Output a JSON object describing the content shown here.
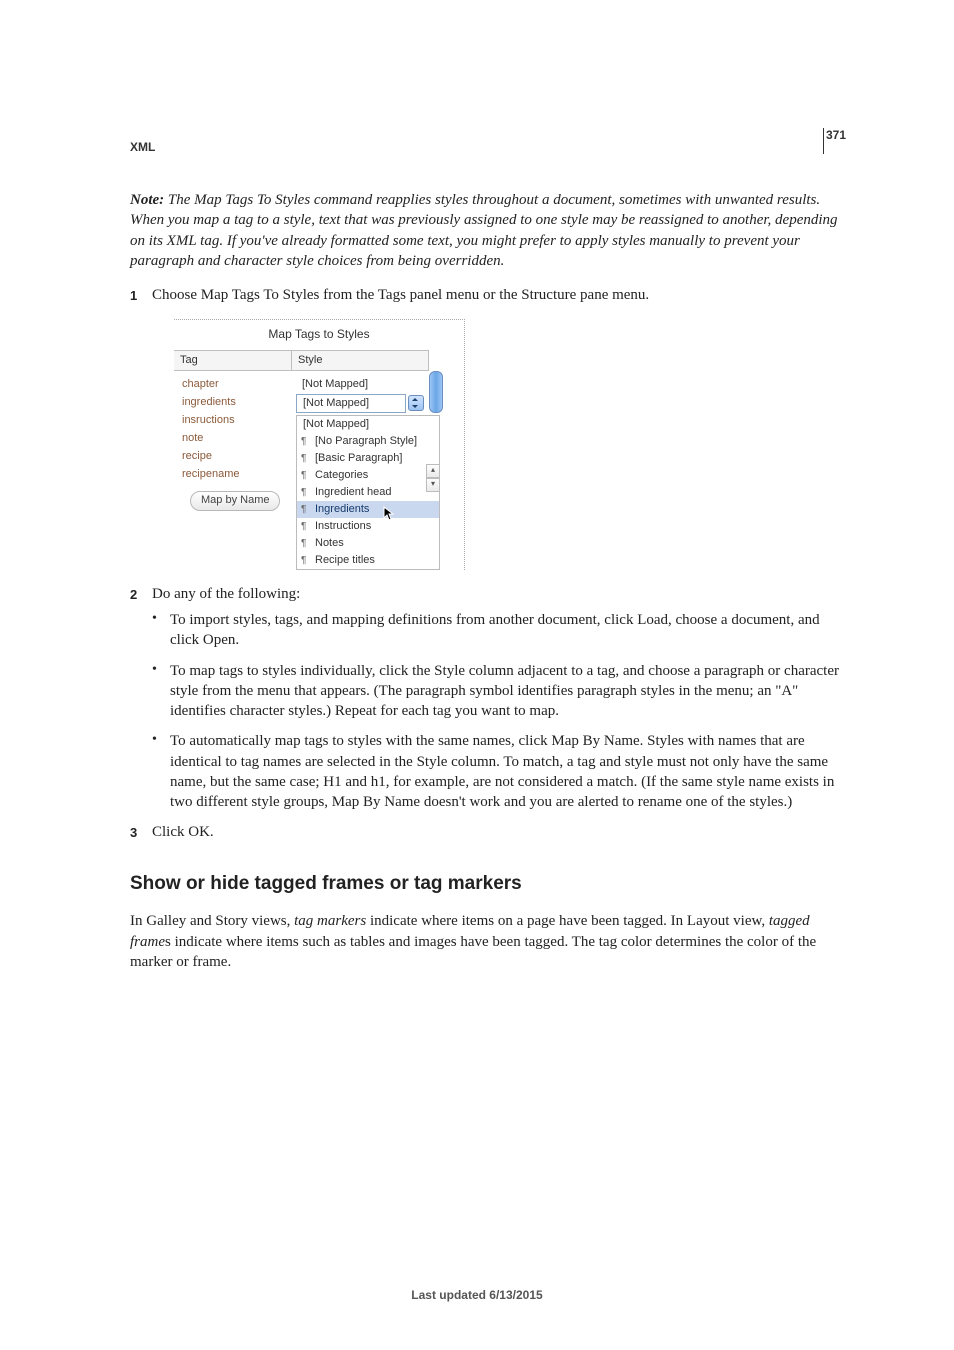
{
  "header": {
    "section": "XML",
    "page_number": "371"
  },
  "note": {
    "label": "Note:",
    "text": "The Map Tags To Styles command reapplies styles throughout a document, sometimes with unwanted results. When you map a tag to a style, text that was previously assigned to one style may be reassigned to another, depending on its XML tag. If you've already formatted some text, you might prefer to apply styles manually to prevent your paragraph and character style choices from being overridden."
  },
  "steps": {
    "s1": "Choose Map Tags To Styles from the Tags panel menu or the Structure pane menu.",
    "s2_intro": "Do any of the following:",
    "s2_bullets": [
      "To import styles, tags, and mapping definitions from another document, click Load, choose a document, and click Open.",
      "To map tags to styles individually, click the Style column adjacent to a tag, and choose a paragraph or character style from the menu that appears. (The paragraph symbol identifies paragraph styles in the menu; an \"A\" identifies character styles.) Repeat for each tag you want to map.",
      "To automatically map tags to styles with the same names, click Map By Name. Styles with names that are identical to tag names are selected in the Style column. To match, a tag and style must not only have the same name, but the same case; H1 and h1, for example, are not considered a match. (If the same style name exists in two different style groups, Map By Name doesn't work and you are alerted to rename one of the styles.)"
    ],
    "s3": "Click OK."
  },
  "subhead": "Show or hide tagged frames or tag markers",
  "subhead_italics": {
    "tm": "tag markers",
    "tf": "tagged frame"
  },
  "subhead_para_parts": {
    "a": "In Galley and Story views, ",
    "b": " indicate where items on a page have been tagged. In Layout view, ",
    "c": "s indicate where items such as tables and images have been tagged. The tag color determines the color of the marker or frame."
  },
  "footer": "Last updated 6/13/2015",
  "dialog": {
    "title": "Map Tags to Styles",
    "headers": {
      "tag": "Tag",
      "style": "Style"
    },
    "tags": [
      "chapter",
      "ingredients",
      "insructions",
      "note",
      "recipe",
      "recipename"
    ],
    "map_button": "Map by Name",
    "style_col": {
      "row1": "[Not Mapped]",
      "row2_field": "[Not Mapped]",
      "dropdown": [
        {
          "label": "[Not Mapped]",
          "plain": true
        },
        {
          "label": "[No Paragraph Style]"
        },
        {
          "label": "[Basic Paragraph]"
        },
        {
          "label": "Categories"
        },
        {
          "label": "Ingredient head"
        },
        {
          "label": "Ingredients",
          "selected": true
        },
        {
          "label": "Instructions"
        },
        {
          "label": "Notes"
        },
        {
          "label": "Recipe titles"
        }
      ]
    }
  }
}
